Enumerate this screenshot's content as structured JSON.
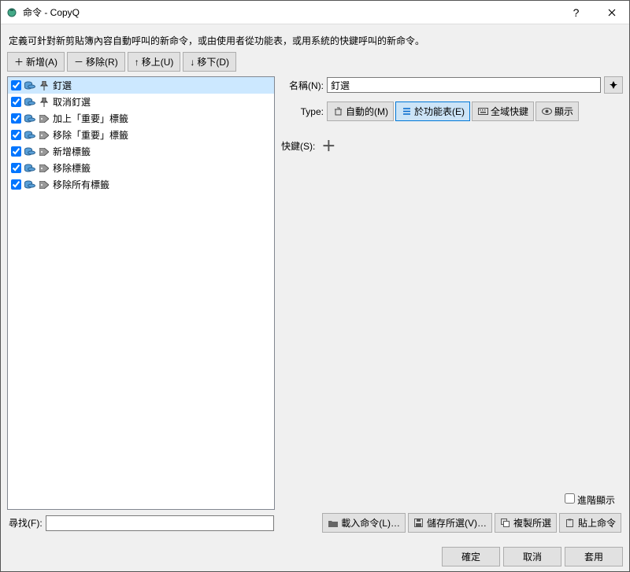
{
  "titlebar": {
    "title": "命令 - CopyQ"
  },
  "description": "定義可針對新剪貼簿內容自動呼叫的新命令，或由使用者從功能表，或用系統的快鍵呼叫的新命令。",
  "toolbar": {
    "add": "新增(A)",
    "remove": "移除(R)",
    "up": "移上(U)",
    "down": "移下(D)"
  },
  "list": {
    "items": [
      {
        "label": "釘選",
        "selected": true
      },
      {
        "label": "取消釘選"
      },
      {
        "label": "加上「重要」標籤"
      },
      {
        "label": "移除「重要」標籤"
      },
      {
        "label": "新增標籤"
      },
      {
        "label": "移除標籤"
      },
      {
        "label": "移除所有標籤"
      }
    ]
  },
  "form": {
    "name_label": "名稱(N):",
    "name_value": "釘選",
    "type_label": "Type:",
    "type_auto": "自動的(M)",
    "type_menu": "於功能表(E)",
    "type_global": "全域快鍵",
    "type_show": "顯示",
    "shortcut_label": "快鍵(S):"
  },
  "advanced": "進階顯示",
  "search": {
    "label": "尋找(F):"
  },
  "bottom": {
    "load": "載入命令(L)…",
    "save": "儲存所選(V)…",
    "copy": "複製所選",
    "paste": "貼上命令"
  },
  "dialog": {
    "ok": "確定",
    "cancel": "取消",
    "apply": "套用"
  }
}
